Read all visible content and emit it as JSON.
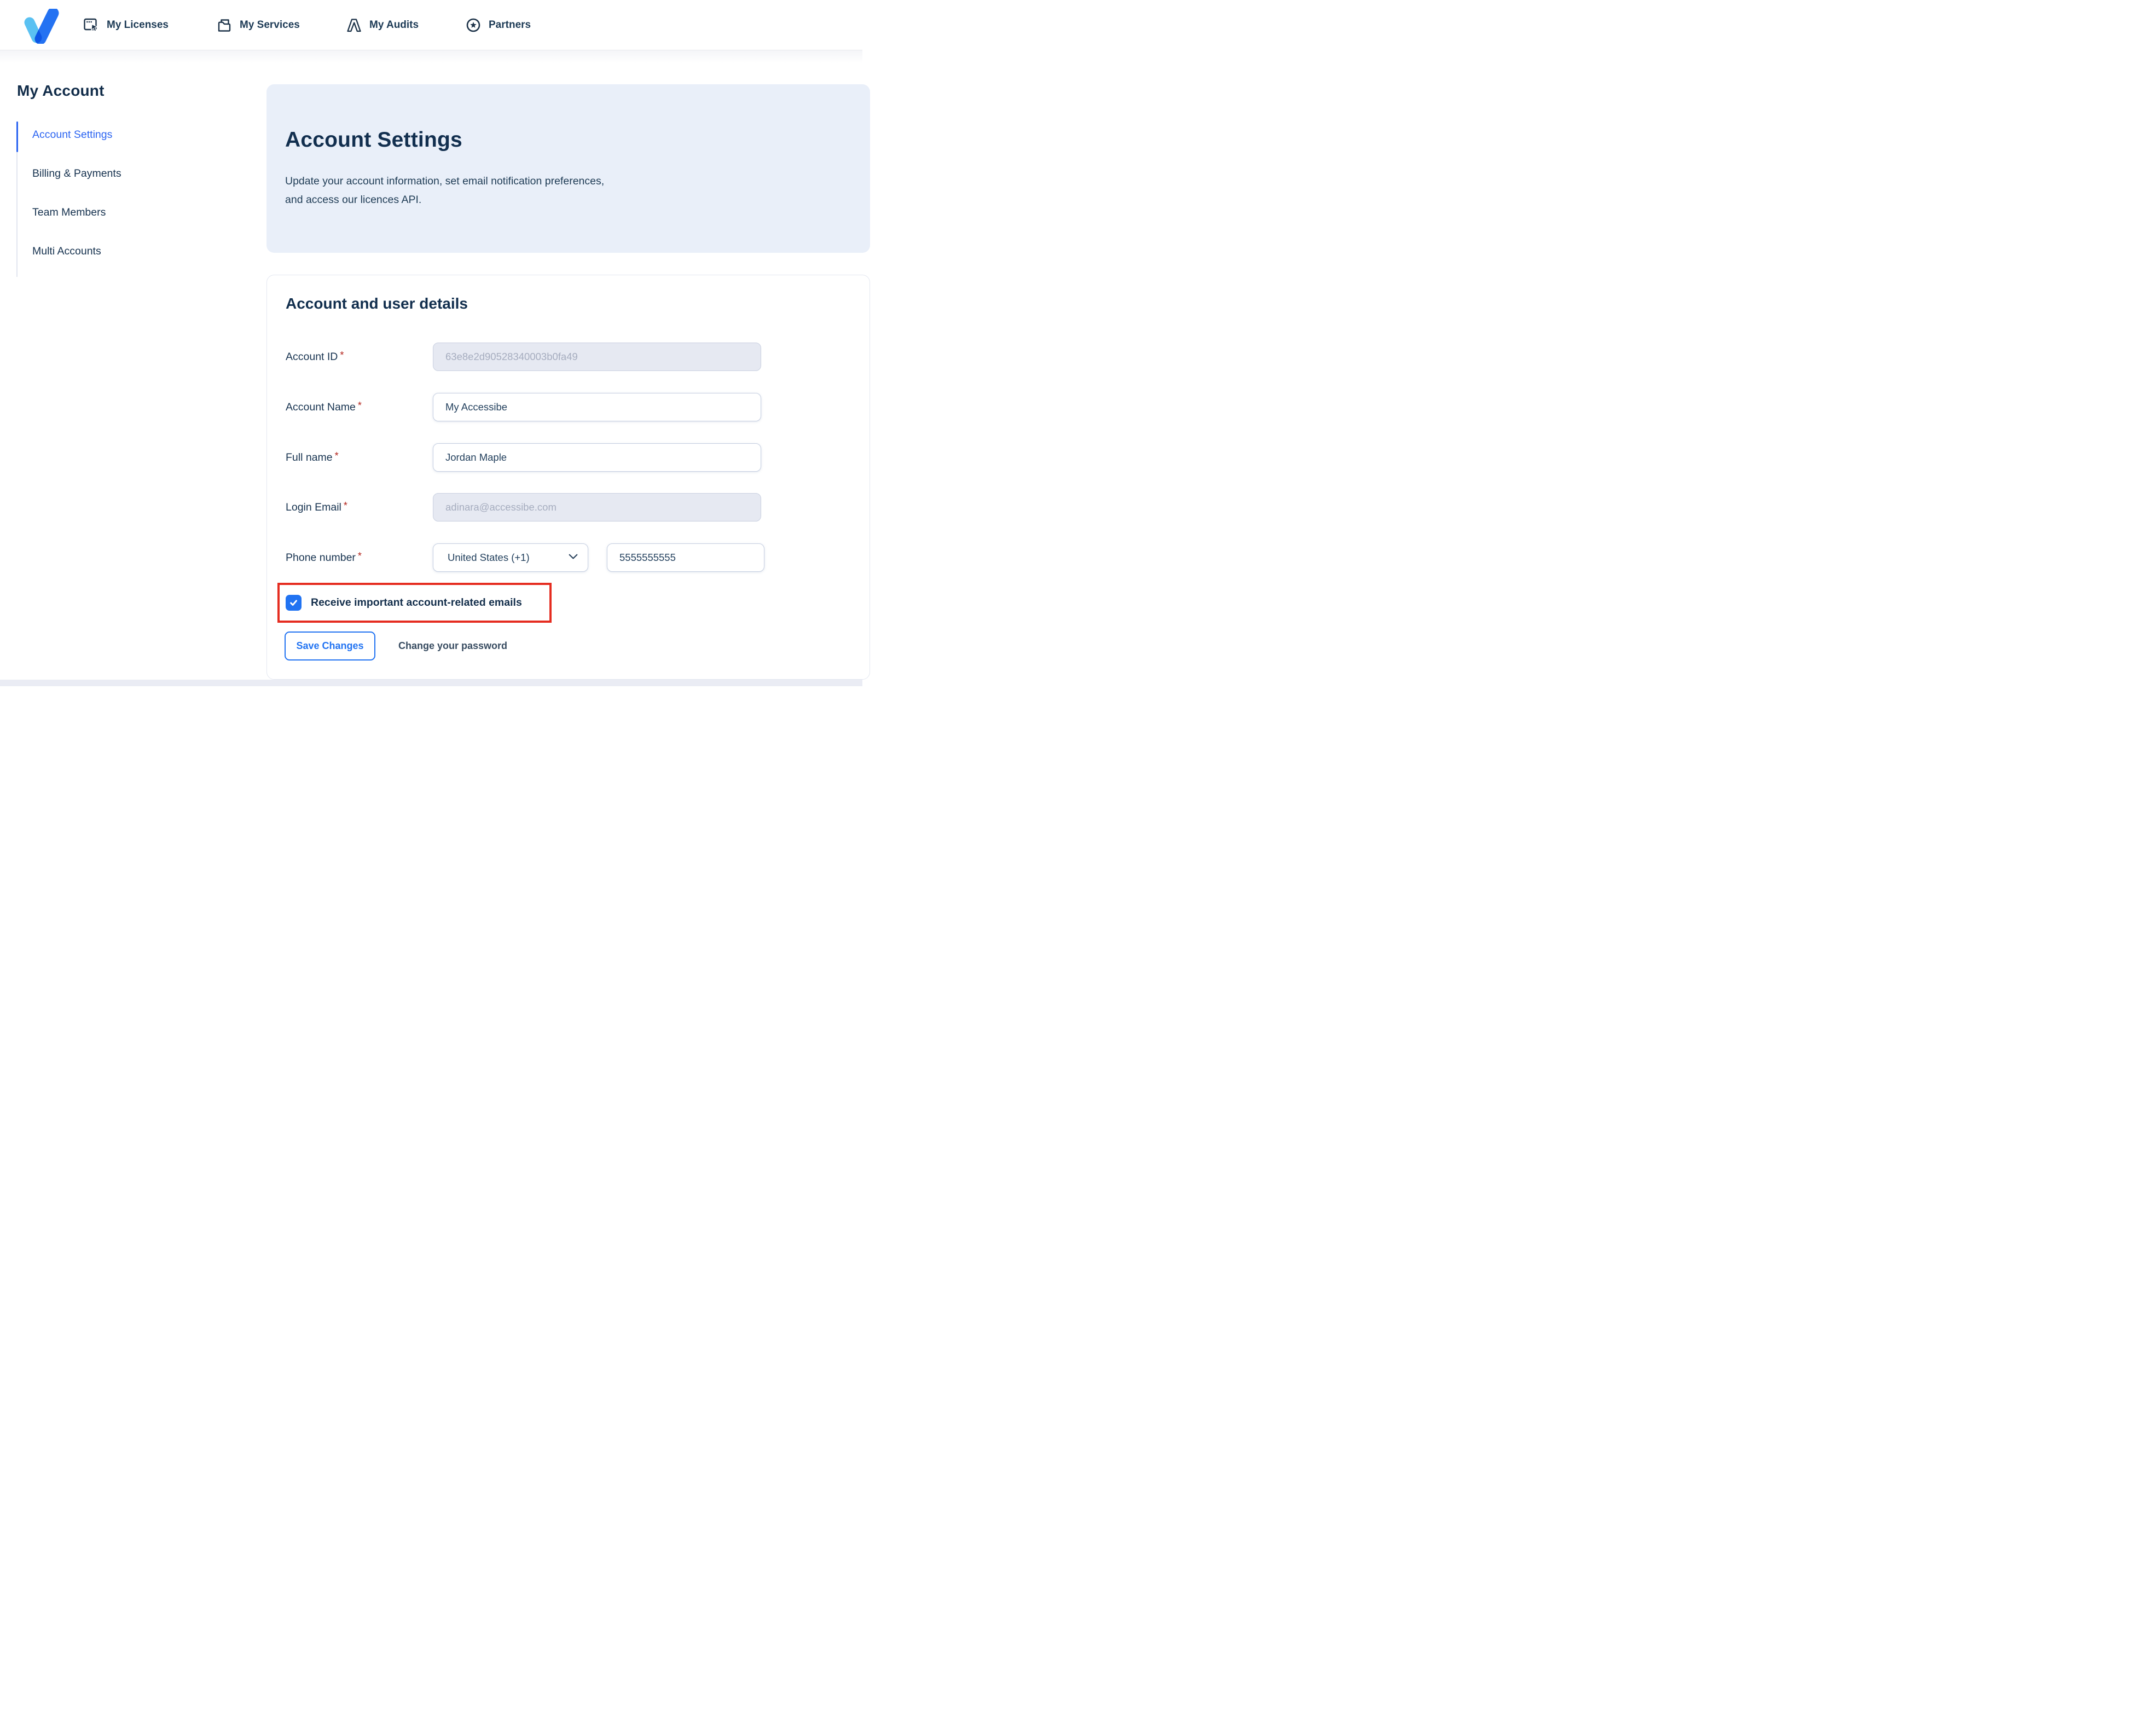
{
  "nav": {
    "items": [
      {
        "label": "My Licenses",
        "icon": "browser-cursor-icon"
      },
      {
        "label": "My Services",
        "icon": "folder-document-icon"
      },
      {
        "label": "My Audits",
        "icon": "audit-mark-icon"
      },
      {
        "label": "Partners",
        "icon": "star-circle-icon"
      }
    ]
  },
  "sidebar": {
    "title": "My Account",
    "items": [
      {
        "label": "Account Settings",
        "active": true
      },
      {
        "label": "Billing & Payments",
        "active": false
      },
      {
        "label": "Team Members",
        "active": false
      },
      {
        "label": "Multi Accounts",
        "active": false
      }
    ]
  },
  "hero": {
    "title": "Account Settings",
    "subtitle_line1": "Update your account information, set email notification preferences,",
    "subtitle_line2": "and access our licences API."
  },
  "form": {
    "section_title": "Account and user details",
    "required_mark": "*",
    "fields": [
      {
        "label": "Account ID",
        "required": true,
        "value": "63e8e2d90528340003b0fa49",
        "disabled": true
      },
      {
        "label": "Account Name",
        "required": true,
        "value": "My Accessibe",
        "disabled": false
      },
      {
        "label": "Full name",
        "required": true,
        "value": "Jordan Maple",
        "disabled": false
      },
      {
        "label": "Login Email",
        "required": true,
        "value": "adinara@accessibe.com",
        "disabled": true
      },
      {
        "label": "Phone number",
        "required": true,
        "country": "United States (+1)",
        "phone": "5555555555"
      }
    ],
    "checkbox": {
      "label": "Receive important account-related emails",
      "checked": true
    },
    "buttons": {
      "save": "Save Changes",
      "change_password": "Change your password"
    }
  },
  "colors": {
    "accent_blue": "#2173f2",
    "sidebar_active_blue": "#2a63f1",
    "navy_text": "#132e4c",
    "hero_panel_bg": "#e9eff9",
    "disabled_input_bg": "#e6e9f2",
    "highlight_red": "#e52c20",
    "logo_light_blue": "#5ac1f2",
    "logo_royal_blue": "#2472f2"
  }
}
